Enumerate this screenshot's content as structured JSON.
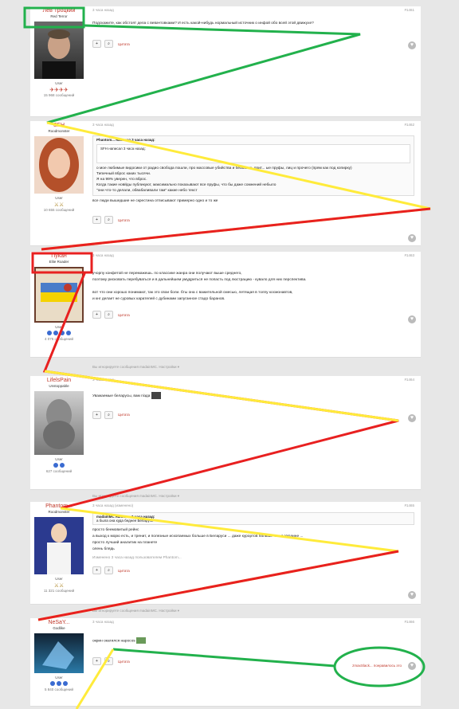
{
  "posts": [
    {
      "author": "Лев Троцкий",
      "rank": "Red Terror",
      "role": "User",
      "count": "15 968 сообщений",
      "meta_time": "3 часа назад",
      "meta_num": "#1461",
      "text": "Подскажите, как обстоят дела с вевачтовками? И есть какой-нибудь нормальный источник о инфой обо всей этой движухе?",
      "quote_label": "Цитата"
    },
    {
      "author": "SFH",
      "rank": "Roodmonster",
      "role": "User",
      "count": "10 655 сообщений",
      "meta_time": "3 часа назад",
      "meta_num": "#1462",
      "quote_head": "Phantom... написал 3 часа назад:",
      "nested_quote": "SFH написал 3 часа назад:",
      "lines": [
        "о мое любимые видосики от радио свобода пошли, про массовые убийства и беззвесть прит... ые пруфы, лиц и прочего (прям как под копирку)",
        "Типичный вброс каких тысячи.",
        "Я на 99% уверен, что вброс.",
        "Когда такие новйды публикуют, максимально показывают все пруфы, что бы даже сомнений небыло",
        "\"они что-то делали, обвабаливали там\" какие небо текст"
      ],
      "after": "все люди вышедшие не скрестина отписывают примерно одно и то же",
      "quote_label": "Цитата"
    },
    {
      "author": "Пукан",
      "rank": "Elite Roader",
      "role": "User",
      "count": "4 075 сообщений",
      "meta_time": "3 часа назад",
      "meta_num": "#1463",
      "lines": [
        "учорпу конфетой не перемажешь. по классике жанра они получают выше среднего,",
        "поэтому рисковать перебуваться и в дальнейшем умудриться не попасть под люстрацию - кувало для них перспектива.",
        "",
        "вот что они хорошо понимают, так это свои боли. бты она с важительной смесью, летящая в толпу космонавтов,",
        "и кнг делает не суровых карателей с дубинами запуганное стадо баранов."
      ],
      "quote_label": "Цитата"
    },
    {
      "author": "LifelsPain",
      "rank": "Unstoppable",
      "role": "User",
      "count": "627 сообщений",
      "meta_time": "3 часа назад",
      "meta_num": "#1464",
      "text": "Уважаемые беларусы, вам пiзда",
      "quote_label": "Цитата"
    },
    {
      "author": "Phantom...",
      "rank": "Roodmonster",
      "role": "User",
      "count": "11 321 сообщений",
      "meta_time": "3 часа назад (изменено)",
      "meta_num": "#1465",
      "quote_head": "madainMC написал 3 часа назад:",
      "quote_text": "а была она куда беднее Беларуси",
      "lines": [
        "просто беемовитый рейнс",
        "а выход к морю есть, и тренит, и полезные ископаемых больше в Беларуси ... даже курортов больше чем в Украине ...",
        "просто лучший аналитик на планете",
        "олень блядь"
      ],
      "edited": "Изменено 3 часа назад пользователем Phantom...",
      "quote_label": "Цитата"
    },
    {
      "author": "NeSaY...",
      "rank": "Godlike",
      "role": "User",
      "count": "5 840 сообщений",
      "meta_time": "3 часа назад",
      "meta_num": "#1466",
      "text": "окрин окатился нароcos",
      "likes": "zmaxSlack... понравилось это",
      "quote_label": "Цитата"
    }
  ],
  "ignored_note": "Вы игнорируете сообщения madainMC. Настройки ▾",
  "ignored_note2": "Вы игнорируете сообщения madainMC. Настройки ▾",
  "ignored_note3": "Вы игнорируете сообщения madainMC. Настройки ▾",
  "colors": {
    "name_red": "#c0392b",
    "green": "#22b14c",
    "yellow": "#ffeb3b",
    "red": "#e82020"
  }
}
